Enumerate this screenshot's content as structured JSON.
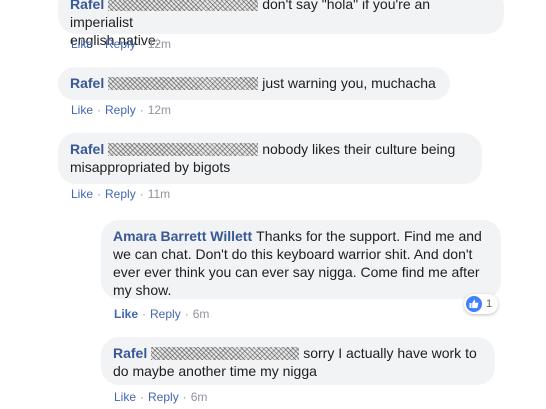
{
  "comments": [
    {
      "author": "Rafel",
      "text_line1": "don't say \"hola\" if you're an imperialist",
      "text_line2": "english native.",
      "actions": {
        "like": "Like",
        "reply": "Reply",
        "time": "12m"
      }
    },
    {
      "author": "Rafel",
      "text": "just warning you, muchacha",
      "actions": {
        "like": "Like",
        "reply": "Reply",
        "time": "12m"
      }
    },
    {
      "author": "Rafel",
      "text_line1": "nobody likes their culture being",
      "text_line2": "misappropriated by bigots",
      "actions": {
        "like": "Like",
        "reply": "Reply",
        "time": "11m"
      }
    }
  ],
  "replies": [
    {
      "author": "Amara Barrett Willett",
      "text": "Thanks for the support. Find me and we can chat. Don't do this keyboard warrior shit. And don't ever ever think you can ever say nigga. Come find me after my show.",
      "reaction_count": "1",
      "actions": {
        "like": "Like",
        "reply": "Reply",
        "time": "6m"
      }
    },
    {
      "author": "Rafel",
      "text_line1": "sorry I actually have work to",
      "text_line2": "do maybe another time my nigga",
      "actions": {
        "like": "Like",
        "reply": "Reply",
        "time": "6m"
      }
    }
  ],
  "icons": {
    "reaction": "like-thumb-icon",
    "redaction": "redacted-name-scribble"
  },
  "colors": {
    "link": "#385898",
    "bubble": "#f2f3f5",
    "meta": "#90949c",
    "like_blue": "#4080ff"
  }
}
